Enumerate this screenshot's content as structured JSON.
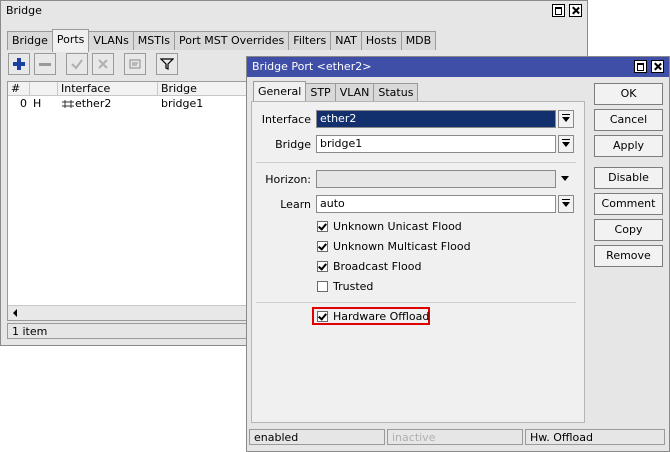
{
  "bridge_window": {
    "title": "Bridge",
    "tabs": [
      "Bridge",
      "Ports",
      "VLANs",
      "MSTIs",
      "Port MST Overrides",
      "Filters",
      "NAT",
      "Hosts",
      "MDB"
    ],
    "active_tab": "Ports",
    "columns": [
      "#",
      "",
      "Interface",
      "Bridge"
    ],
    "rows": [
      {
        "num": "0",
        "flag": "H",
        "interface": "ether2",
        "bridge": "bridge1"
      }
    ],
    "status": "1 item"
  },
  "dialog": {
    "title": "Bridge Port <ether2>",
    "tabs": [
      "General",
      "STP",
      "VLAN",
      "Status"
    ],
    "active_tab": "General",
    "interface_label": "Interface",
    "interface_value": "ether2",
    "bridge_label": "Bridge",
    "bridge_value": "bridge1",
    "horizon_label": "Horizon:",
    "horizon_value": "",
    "learn_label": "Learn",
    "learn_value": "auto",
    "checkboxes": [
      {
        "label": "Unknown Unicast Flood",
        "checked": true
      },
      {
        "label": "Unknown Multicast Flood",
        "checked": true
      },
      {
        "label": "Broadcast Flood",
        "checked": true
      },
      {
        "label": "Trusted",
        "checked": false
      }
    ],
    "hw_offload": {
      "label": "Hardware Offload",
      "checked": true
    },
    "buttons": [
      "OK",
      "Cancel",
      "Apply",
      "Disable",
      "Comment",
      "Copy",
      "Remove"
    ],
    "status": [
      "enabled",
      "inactive",
      "Hw. Offload"
    ]
  },
  "colors": {
    "selection": "#12306d",
    "highlight_border": "#e00000",
    "title_bg": "#e6e6e6",
    "dialog_title_bg": "#3f4fa8"
  }
}
